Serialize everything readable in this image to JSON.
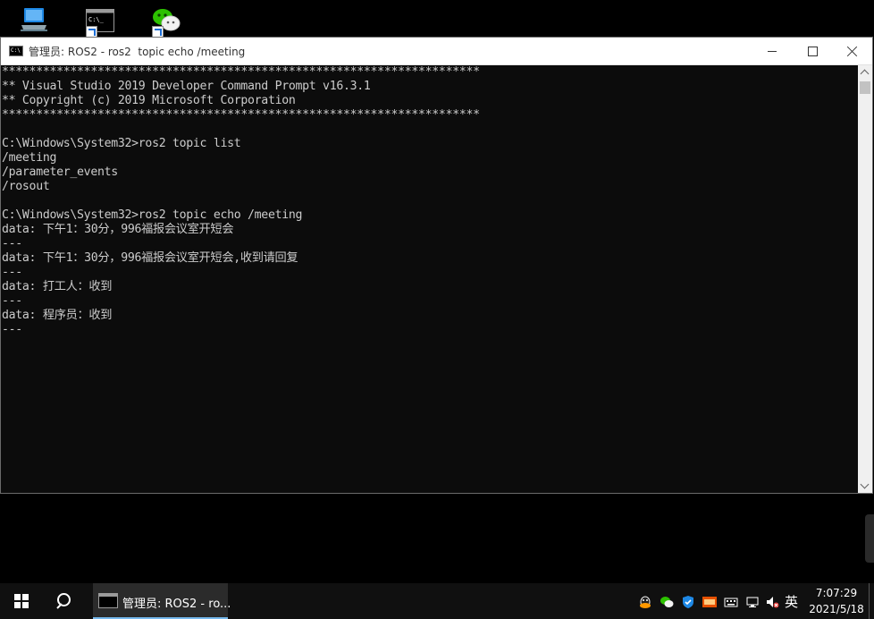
{
  "desktop": {
    "icons": [
      {
        "name": "this-pc",
        "icon": "computer-icon"
      },
      {
        "name": "command-prompt-shortcut",
        "icon": "cmd-icon",
        "glyph": "C:\\_"
      },
      {
        "name": "wechat-shortcut",
        "icon": "wechat-icon"
      }
    ]
  },
  "window": {
    "title": "管理员: ROS2 - ros2  topic echo /meeting",
    "icon": "cmd-icon",
    "icon_glyph": "C:\\",
    "colors": {
      "background": "#0c0c0c",
      "text": "#cccccc",
      "titlebar": "#ffffff"
    },
    "lines": [
      "**********************************************************************",
      "** Visual Studio 2019 Developer Command Prompt v16.3.1",
      "** Copyright (c) 2019 Microsoft Corporation",
      "**********************************************************************",
      "",
      "C:\\Windows\\System32>ros2 topic list",
      "/meeting",
      "/parameter_events",
      "/rosout",
      "",
      "C:\\Windows\\System32>ros2 topic echo /meeting",
      "data: 下午1：30分，996福报会议室开短会",
      "---",
      "data: 下午1：30分，996福报会议室开短会,收到请回复",
      "---",
      "data: 打工人：收到",
      "---",
      "data: 程序员：收到",
      "---"
    ]
  },
  "taskbar": {
    "task_label": "管理员: ROS2 - ro...",
    "ime": "英",
    "time": "7:07:29",
    "date": "2021/5/18",
    "accent": "#76b9ed"
  }
}
